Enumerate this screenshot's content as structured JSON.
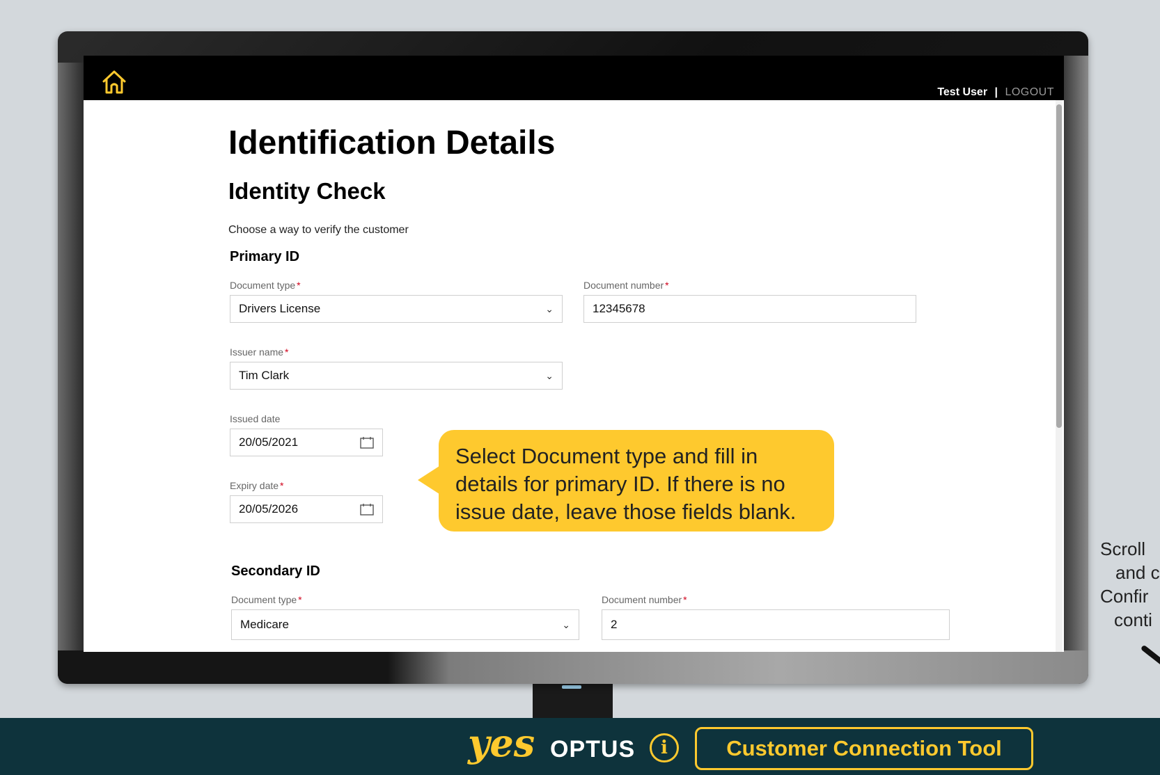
{
  "app": {
    "user_name": "Test User",
    "separator": "|",
    "logout_label": "LOGOUT"
  },
  "page": {
    "title": "Identification Details",
    "section_title": "Identity Check",
    "instruction": "Choose a way to verify the customer"
  },
  "primary_id": {
    "heading": "Primary ID",
    "document_type": {
      "label": "Document type",
      "value": "Drivers License"
    },
    "document_number": {
      "label": "Document number",
      "value": "12345678"
    },
    "issuer_name": {
      "label": "Issuer name",
      "value": "Tim Clark"
    },
    "issued_date": {
      "label": "Issued date",
      "value": "20/05/2021"
    },
    "expiry_date": {
      "label": "Expiry date",
      "value": "20/05/2026"
    }
  },
  "secondary_id": {
    "heading": "Secondary ID",
    "document_type": {
      "label": "Document type",
      "value": "Medicare"
    },
    "document_number": {
      "label": "Document number",
      "value": "2"
    }
  },
  "required_marker": "*",
  "callout": {
    "line1": "Select Document type and fill in",
    "line2": "details for primary ID. If there is no",
    "line3": "issue date, leave those fields blank."
  },
  "side_hint": {
    "line1": "Scroll",
    "line2": "and c",
    "line3": "Confir",
    "line4": "conti"
  },
  "footer": {
    "brand_yes": "yes",
    "brand_optus": "OPTUS",
    "info_glyph": "i",
    "tool_name": "Customer Connection Tool"
  },
  "colors": {
    "accent_yellow": "#fec92e",
    "footer_bg": "#0e333c",
    "required_red": "#d0021b"
  },
  "icons": [
    "home-icon",
    "chevron-down-icon",
    "calendar-icon",
    "info-icon"
  ]
}
